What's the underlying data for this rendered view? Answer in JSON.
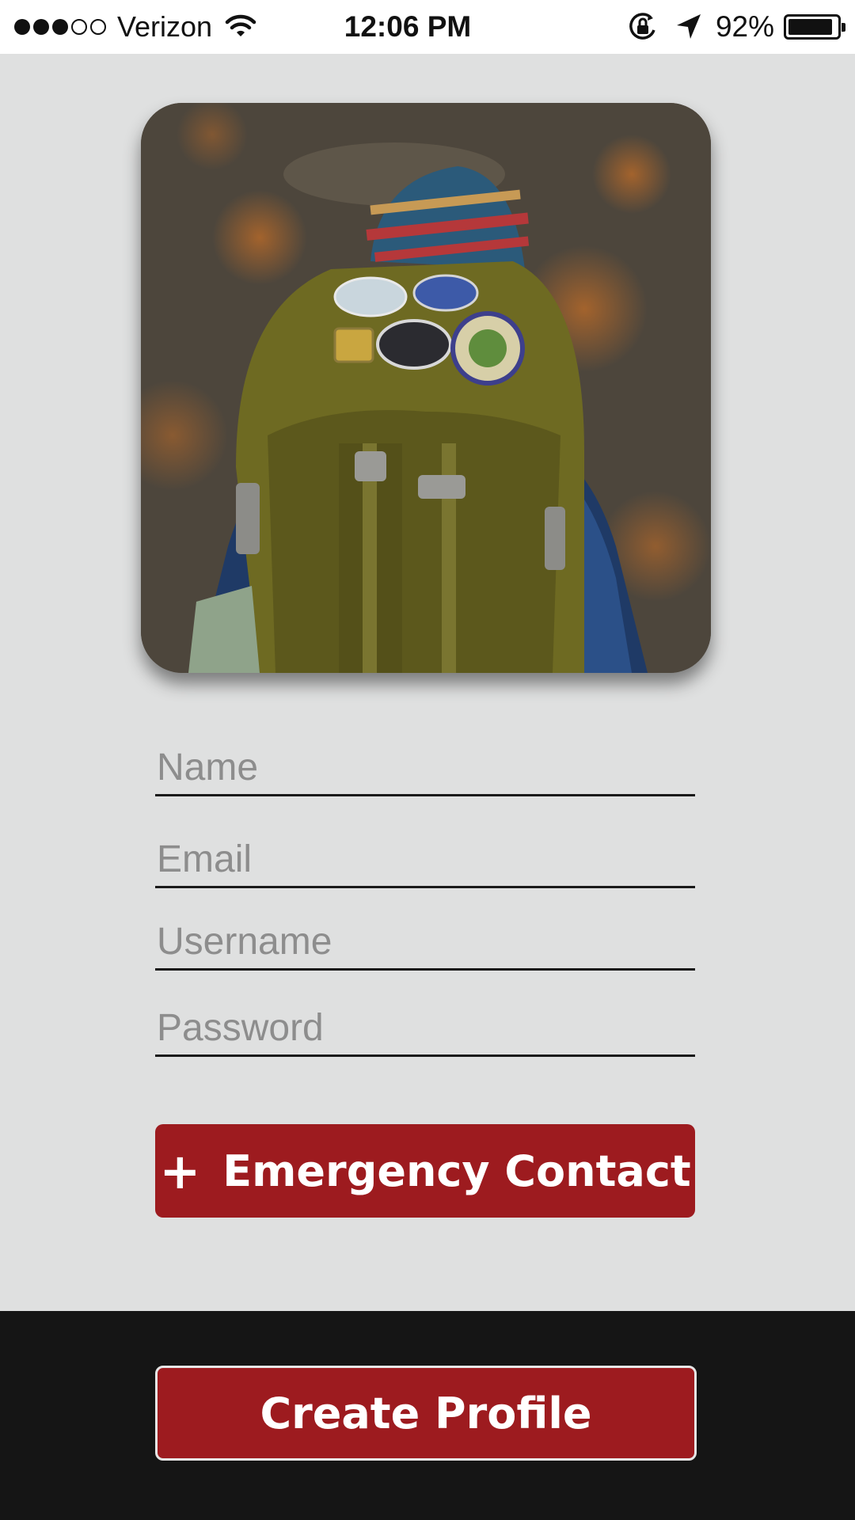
{
  "status_bar": {
    "carrier": "Verizon",
    "signal_bars": 3,
    "signal_total": 5,
    "time": "12:06 PM",
    "battery_percent": "92%",
    "battery_level": 0.92,
    "icons": [
      "wifi-icon",
      "orientation-lock-icon",
      "location-arrow-icon",
      "battery-icon"
    ]
  },
  "hero_photo": {
    "icon": "hiker-backpack-photo"
  },
  "form": {
    "name_placeholder": "Name",
    "email_placeholder": "Email",
    "username_placeholder": "Username",
    "password_placeholder": "Password"
  },
  "buttons": {
    "emergency_plus": "+",
    "emergency_label": "Emergency Contact",
    "create_profile_label": "Create Profile"
  },
  "colors": {
    "accent_red": "#9d1b1f",
    "background": "#dfe0e0",
    "footer": "#151515"
  }
}
